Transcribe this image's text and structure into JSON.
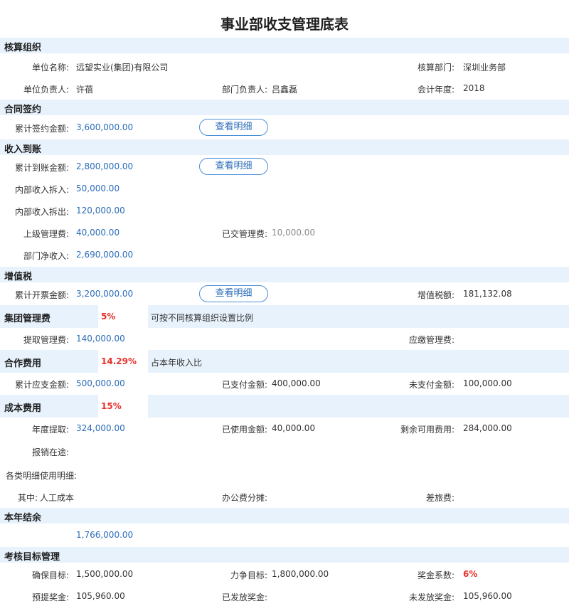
{
  "page": {
    "title": "事业部收支管理底表"
  },
  "accounting_org": {
    "header": "核算组织",
    "unit_name_label": "单位名称:",
    "unit_name": "远望实业(集团)有限公司",
    "dept_label": "核算部门:",
    "dept": "深圳业务部",
    "unit_head_label": "单位负责人:",
    "unit_head": "许蓓",
    "dept_head_label": "部门负责人:",
    "dept_head": "吕鑫磊",
    "fiscal_year_label": "会计年度:",
    "fiscal_year": "2018"
  },
  "contract": {
    "header": "合同签约",
    "total_signed_label": "累计签约金额:",
    "total_signed": "3,600,000.00",
    "detail_button": "查看明细"
  },
  "income": {
    "header": "收入到账",
    "total_received_label": "累计到账金额:",
    "total_received": "2,800,000.00",
    "detail_button": "查看明细",
    "internal_in_label": "内部收入拆入:",
    "internal_in": "50,000.00",
    "internal_out_label": "内部收入拆出:",
    "internal_out": "120,000.00",
    "upper_fee_label": "上级管理费:",
    "upper_fee": "40,000.00",
    "paid_fee_label": "已交管理费:",
    "paid_fee": "10,000.00",
    "net_income_label": "部门净收入:",
    "net_income": "2,690,000.00"
  },
  "vat": {
    "header": "增值税",
    "total_invoiced_label": "累计开票金额:",
    "total_invoiced": "3,200,000.00",
    "detail_button": "查看明细",
    "vat_amount_label": "增值税额:",
    "vat_amount": "181,132.08"
  },
  "group_fee": {
    "header": "集团管理费",
    "rate": "5%",
    "note": "可按不同核算组织设置比例",
    "extracted_label": "提取管理费:",
    "extracted": "140,000.00",
    "payable_label": "应缴管理费:",
    "payable": ""
  },
  "cooperation": {
    "header": "合作费用",
    "rate": "14.29%",
    "note": "占本年收入比",
    "payable_label": "累计应支金额:",
    "payable": "500,000.00",
    "paid_label": "已支付金额:",
    "paid": "400,000.00",
    "unpaid_label": "未支付金额:",
    "unpaid": "100,000.00"
  },
  "cost": {
    "header": "成本费用",
    "rate": "15%",
    "note": "",
    "annual_label": "年度提取:",
    "annual": "324,000.00",
    "used_label": "已使用金额:",
    "used": "40,000.00",
    "remaining_label": "剩余可用费用:",
    "remaining": "284,000.00",
    "reimburse_label": "报销在途:",
    "reimburse": "",
    "detail_label": "各类明细使用明细:",
    "labor_label": "其中:",
    "labor": "人工成本",
    "office_label": "办公费分摊:",
    "office": "",
    "travel_label": "差旅费:",
    "travel": ""
  },
  "balance": {
    "header": "本年结余",
    "amount": "1,766,000.00"
  },
  "kpi": {
    "header": "考核目标管理",
    "guaranteed_label": "确保目标:",
    "guaranteed": "1,500,000.00",
    "strive_label": "力争目标:",
    "strive": "1,800,000.00",
    "bonus_coef_label": "奖金系数:",
    "bonus_coef": "6%",
    "accrued_label": "预提奖金:",
    "accrued": "105,960.00",
    "issued_label": "已发放奖金:",
    "issued": "",
    "unissued_label": "未发放奖金:",
    "unissued": "105,960.00"
  },
  "colors": {
    "band": "#e8f2fc",
    "value_blue": "#2a6cb8",
    "accent_red": "#e8302c",
    "button_border": "#4a8fd9"
  }
}
